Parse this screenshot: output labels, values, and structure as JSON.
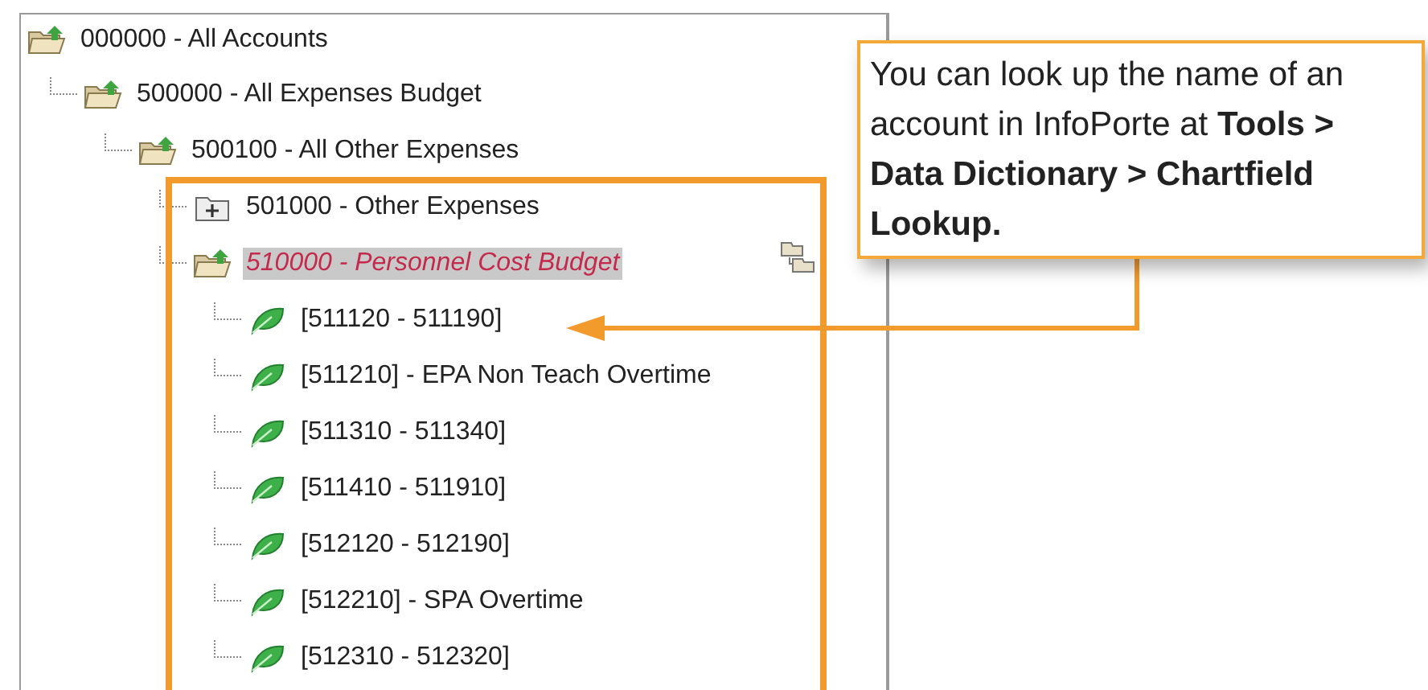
{
  "tree": [
    {
      "label": "000000 - All Accounts",
      "kind": "folder-open",
      "selected": false,
      "children": [
        {
          "label": "500000 - All Expenses Budget",
          "kind": "folder-open",
          "selected": false,
          "children": [
            {
              "label": "500100 - All Other Expenses",
              "kind": "folder-open",
              "selected": false,
              "children": [
                {
                  "label": "501000 - Other Expenses",
                  "kind": "folder-closed",
                  "selected": false
                },
                {
                  "label": "510000 - Personnel Cost Budget",
                  "kind": "folder-open",
                  "selected": true,
                  "children": [
                    {
                      "label": "[511120 - 511190]",
                      "kind": "leaf",
                      "selected": false
                    },
                    {
                      "label": "[511210] - EPA Non Teach Overtime",
                      "kind": "leaf",
                      "selected": false
                    },
                    {
                      "label": "[511310 - 511340]",
                      "kind": "leaf",
                      "selected": false
                    },
                    {
                      "label": "[511410 - 511910]",
                      "kind": "leaf",
                      "selected": false
                    },
                    {
                      "label": "[512120 - 512190]",
                      "kind": "leaf",
                      "selected": false
                    },
                    {
                      "label": "[512210] - SPA Overtime",
                      "kind": "leaf",
                      "selected": false
                    },
                    {
                      "label": "[512310 - 512320]",
                      "kind": "leaf",
                      "selected": false
                    }
                  ]
                }
              ]
            }
          ]
        }
      ]
    }
  ],
  "callout": {
    "text": "You can look up the name of an account in InfoPorte at **Tools > Data Dictionary > Chartfield Lookup.**"
  }
}
